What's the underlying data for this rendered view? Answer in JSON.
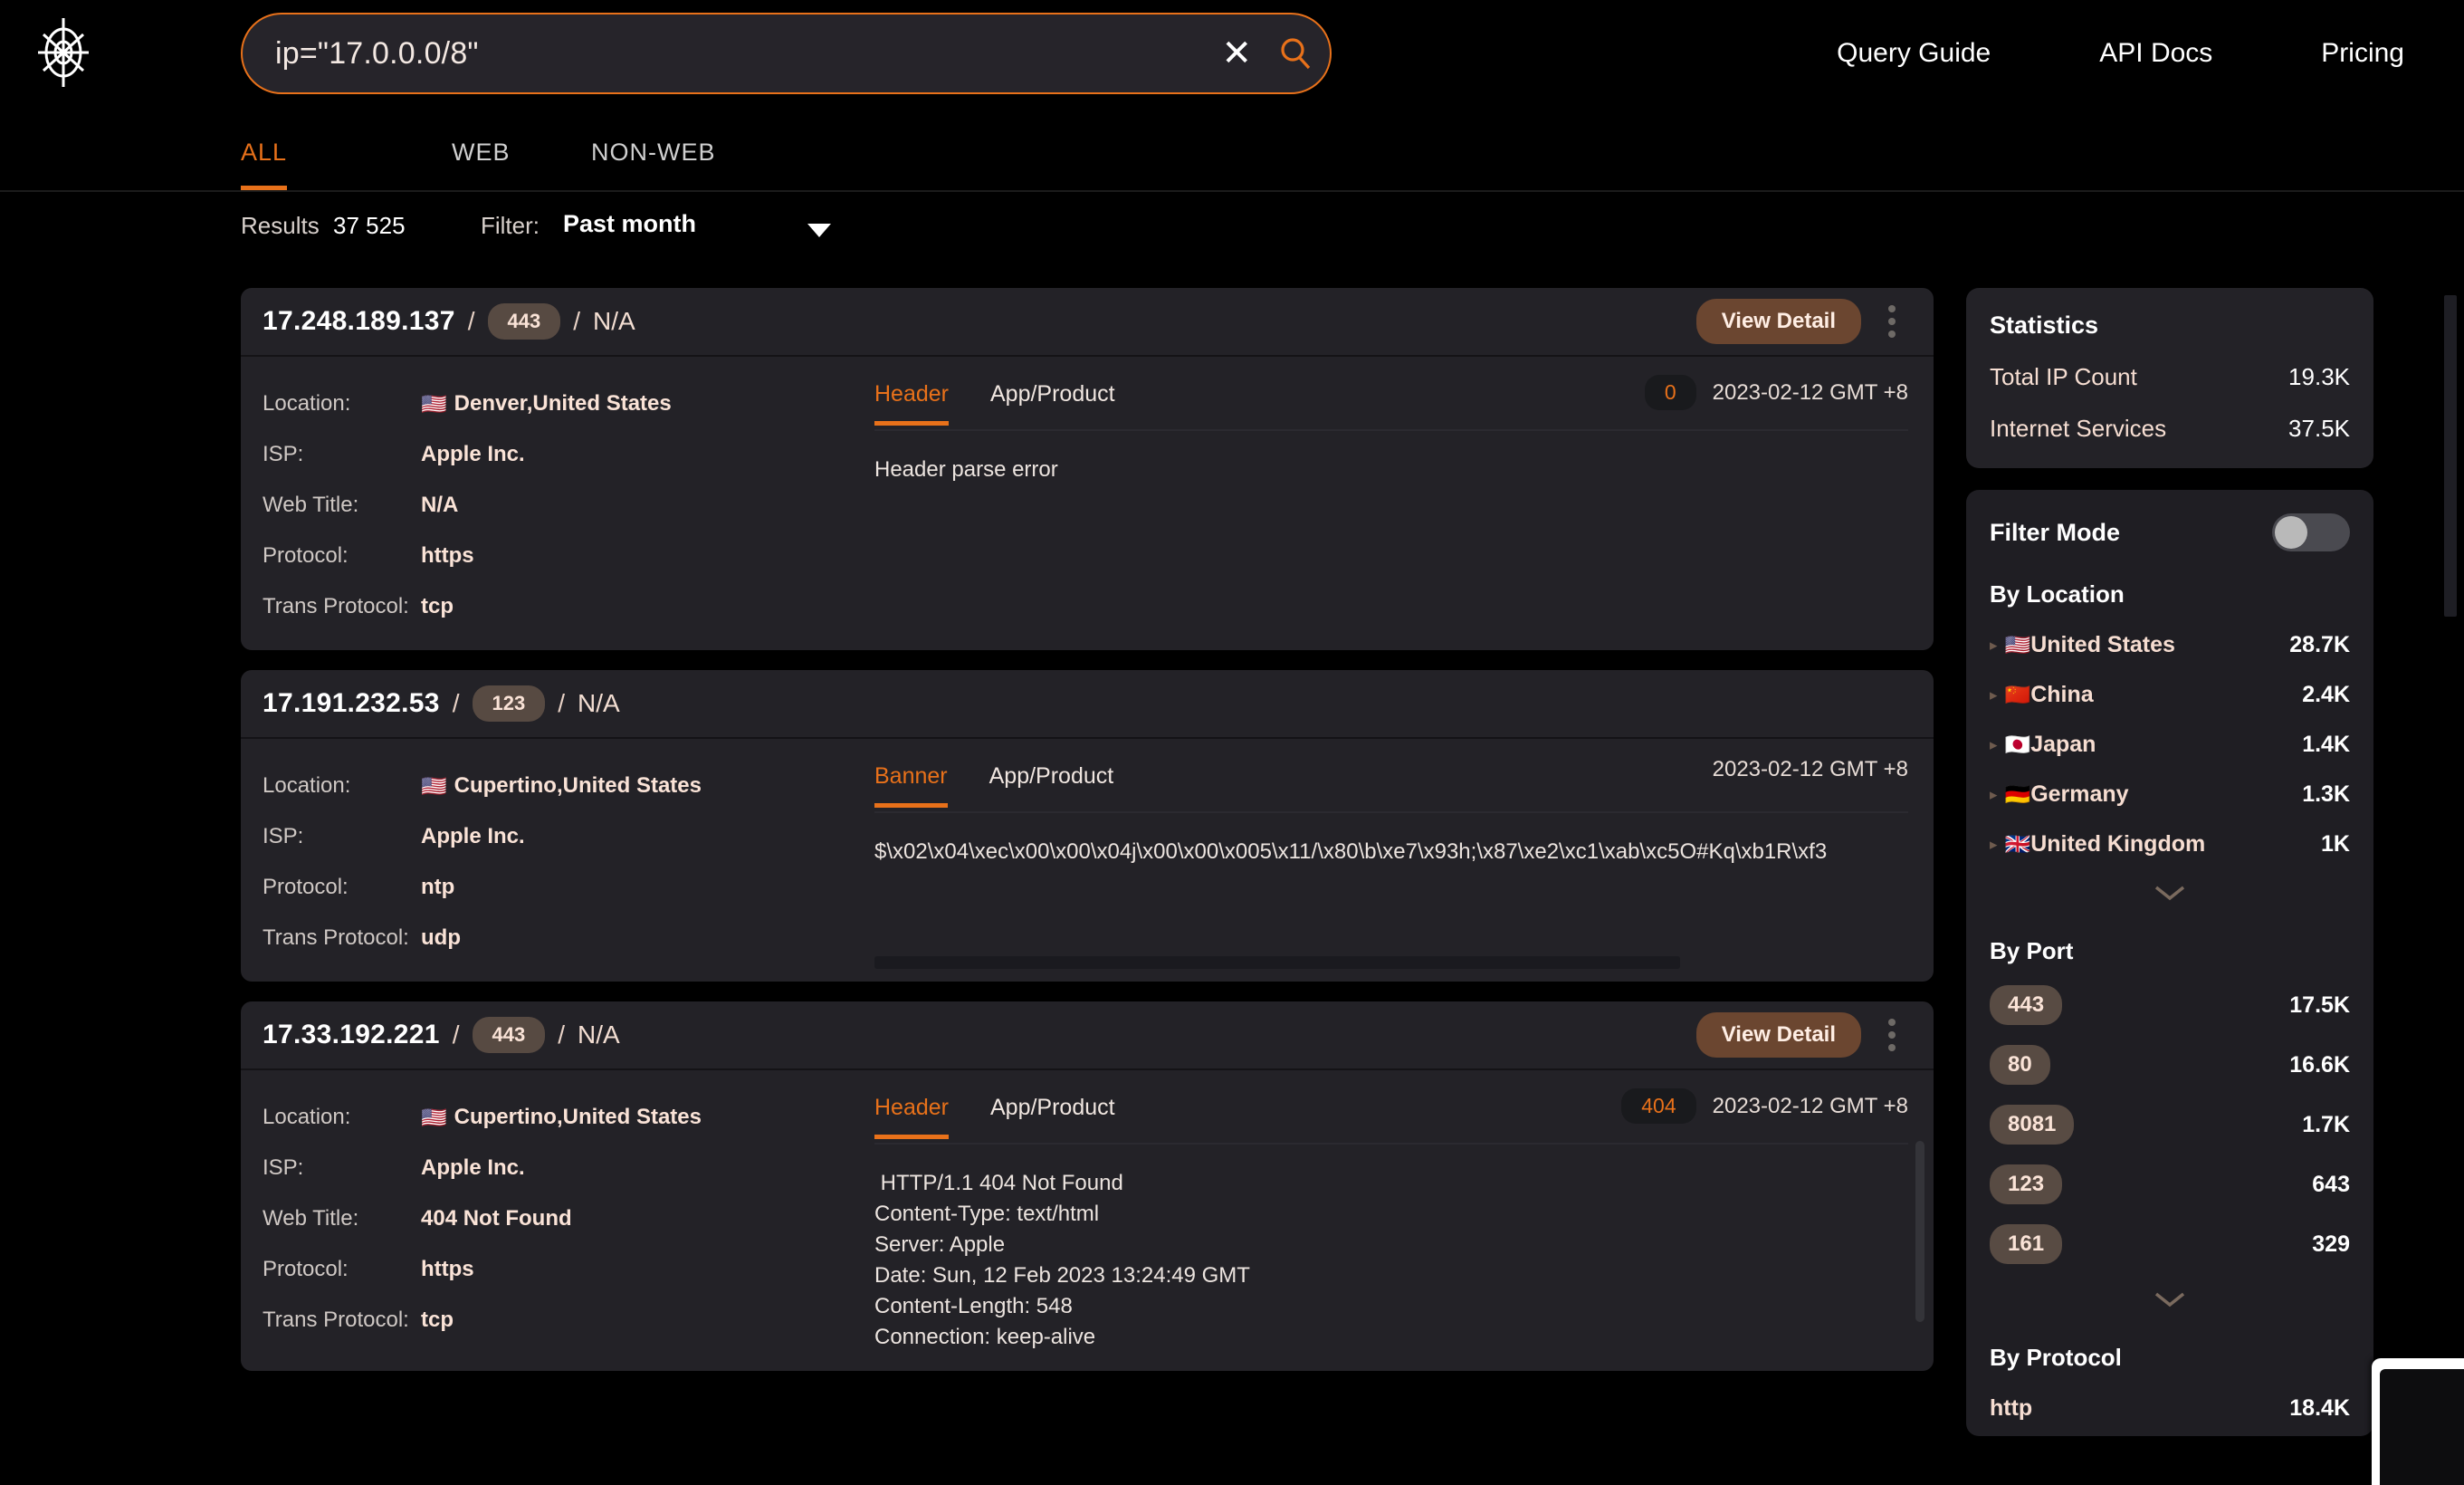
{
  "header": {
    "logo_icon": "crosshair-target-icon",
    "search": {
      "value": "ip=\"17.0.0.0/8\"",
      "placeholder": "",
      "clear_icon": "close-icon",
      "search_icon": "search-icon"
    },
    "nav": [
      {
        "label": "Query Guide",
        "name": "query-guide"
      },
      {
        "label": "API Docs",
        "name": "api-docs"
      },
      {
        "label": "Pricing",
        "name": "pricing"
      }
    ]
  },
  "tabs": [
    {
      "label": "ALL",
      "active": true
    },
    {
      "label": "WEB",
      "active": false
    },
    {
      "label": "NON-WEB",
      "active": false
    }
  ],
  "results_bar": {
    "results_label": "Results",
    "results_count": "37 525",
    "filter_label": "Filter:",
    "filter_value": "Past month",
    "caret_icon": "chevron-down-icon"
  },
  "field_labels": {
    "location": "Location:",
    "isp": "ISP:",
    "web_title": "Web Title:",
    "protocol": "Protocol:",
    "trans_protocol": "Trans Protocol:"
  },
  "common": {
    "view_detail": "View Detail",
    "kebab_icon": "more-vertical-icon",
    "slash": "/",
    "na": "N/A",
    "tab_app_product": "App/Product"
  },
  "cards": [
    {
      "ip": "17.248.189.137",
      "port": "443",
      "title": "N/A",
      "has_view_detail": true,
      "location": "Denver,United States",
      "flag": "🇺🇸",
      "isp": "Apple Inc.",
      "web_title": "N/A",
      "protocol": "https",
      "trans_protocol": "tcp",
      "show_web_title": true,
      "content_tab": "Header",
      "status": "0",
      "show_status": true,
      "timestamp": "2023-02-12 GMT +8",
      "payload": "Header parse error",
      "has_hscroll": false,
      "has_vscroll": false
    },
    {
      "ip": "17.191.232.53",
      "port": "123",
      "title": "N/A",
      "has_view_detail": false,
      "location": "Cupertino,United States",
      "flag": "🇺🇸",
      "isp": "Apple Inc.",
      "web_title": "",
      "protocol": "ntp",
      "trans_protocol": "udp",
      "show_web_title": false,
      "content_tab": "Banner",
      "status": "",
      "show_status": false,
      "timestamp": "2023-02-12 GMT +8",
      "payload": "$\\x02\\x04\\xec\\x00\\x00\\x04j\\x00\\x00\\x005\\x11/\\x80\\b\\xe7\\x93h;\\x87\\xe2\\xc1\\xab\\xc5O#Kq\\xb1R\\xf3",
      "has_hscroll": true,
      "has_vscroll": false
    },
    {
      "ip": "17.33.192.221",
      "port": "443",
      "title": "N/A",
      "has_view_detail": true,
      "location": "Cupertino,United States",
      "flag": "🇺🇸",
      "isp": "Apple Inc.",
      "web_title": "404 Not Found",
      "protocol": "https",
      "trans_protocol": "tcp",
      "show_web_title": true,
      "content_tab": "Header",
      "status": "404",
      "show_status": true,
      "timestamp": "2023-02-12 GMT +8",
      "payload": " HTTP/1.1 404 Not Found\nContent-Type: text/html\nServer: Apple\nDate: Sun, 12 Feb 2023 13:24:49 GMT\nContent-Length: 548\nConnection: keep-alive",
      "has_hscroll": false,
      "has_vscroll": true
    }
  ],
  "sidebar": {
    "statistics": {
      "title": "Statistics",
      "rows": [
        {
          "label": "Total IP Count",
          "value": "19.3K"
        },
        {
          "label": "Internet Services",
          "value": "37.5K"
        }
      ]
    },
    "filter_mode": {
      "label": "Filter Mode",
      "enabled": false
    },
    "by_location": {
      "title": "By Location",
      "items": [
        {
          "flag": "🇺🇸",
          "label": "United States",
          "value": "28.7K"
        },
        {
          "flag": "🇨🇳",
          "label": "China",
          "value": "2.4K"
        },
        {
          "flag": "🇯🇵",
          "label": "Japan",
          "value": "1.4K"
        },
        {
          "flag": "🇩🇪",
          "label": "Germany",
          "value": "1.3K"
        },
        {
          "flag": "🇬🇧",
          "label": "United Kingdom",
          "value": "1K"
        }
      ],
      "expand_icon": "chevron-down-icon"
    },
    "by_port": {
      "title": "By Port",
      "items": [
        {
          "label": "443",
          "value": "17.5K"
        },
        {
          "label": "80",
          "value": "16.6K"
        },
        {
          "label": "8081",
          "value": "1.7K"
        },
        {
          "label": "123",
          "value": "643"
        },
        {
          "label": "161",
          "value": "329"
        }
      ],
      "expand_icon": "chevron-down-icon"
    },
    "by_protocol": {
      "title": "By Protocol",
      "items": [
        {
          "label": "http",
          "value": "18.4K"
        }
      ]
    }
  },
  "colors": {
    "accent": "#e8711a",
    "card_bg": "#232227",
    "page_bg": "#000000",
    "text_warm": "#fae3d7"
  }
}
